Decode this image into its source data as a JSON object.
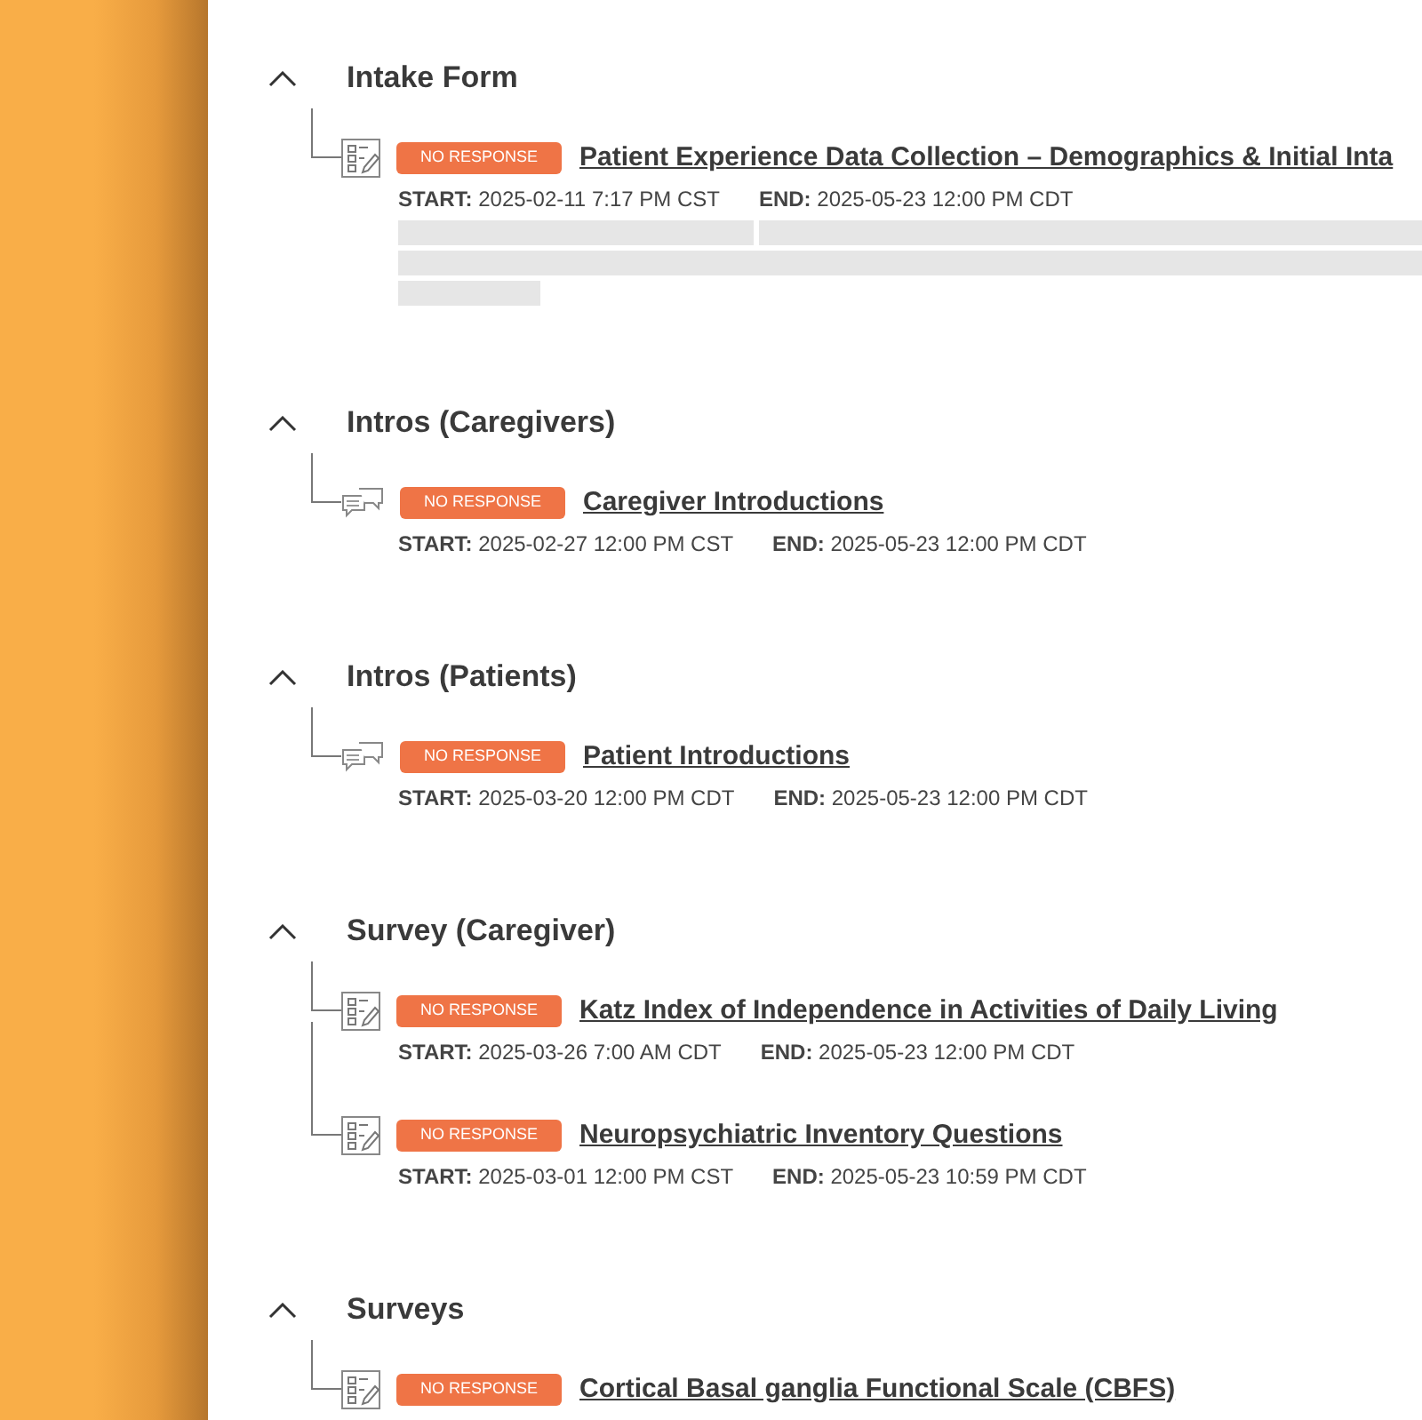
{
  "sections": [
    {
      "title": "Intake Form",
      "expanded": true,
      "items": [
        {
          "kind": "form",
          "status": "NO RESPONSE",
          "title": "Patient Experience Data Collection – Demographics & Initial Inta",
          "start_label": "START:",
          "start": "2025-02-11 7:17 PM CST",
          "end_label": "END:",
          "end": "2025-05-23 12:00 PM CDT",
          "redacted": true
        }
      ]
    },
    {
      "title": "Intros (Caregivers)",
      "expanded": true,
      "items": [
        {
          "kind": "chat",
          "status": "NO RESPONSE",
          "title": "Caregiver Introductions",
          "start_label": "START:",
          "start": "2025-02-27 12:00 PM CST",
          "end_label": "END:",
          "end": "2025-05-23 12:00 PM CDT"
        }
      ]
    },
    {
      "title": "Intros (Patients)",
      "expanded": true,
      "items": [
        {
          "kind": "chat",
          "status": "NO RESPONSE",
          "title": "Patient Introductions",
          "start_label": "START:",
          "start": "2025-03-20 12:00 PM CDT",
          "end_label": "END:",
          "end": "2025-05-23 12:00 PM CDT"
        }
      ]
    },
    {
      "title": "Survey (Caregiver)",
      "expanded": true,
      "items": [
        {
          "kind": "form",
          "status": "NO RESPONSE",
          "title": "Katz Index of Independence in Activities of Daily Living",
          "start_label": "START:",
          "start": "2025-03-26 7:00 AM CDT",
          "end_label": "END:",
          "end": "2025-05-23 12:00 PM CDT"
        },
        {
          "kind": "form",
          "status": "NO RESPONSE",
          "title": "Neuropsychiatric Inventory Questions",
          "start_label": "START:",
          "start": "2025-03-01 12:00 PM CST",
          "end_label": "END:",
          "end": "2025-05-23 10:59 PM CDT"
        }
      ]
    },
    {
      "title": "Surveys",
      "expanded": true,
      "items": [
        {
          "kind": "form",
          "status": "NO RESPONSE",
          "title": "Cortical Basal ganglia Functional Scale (CBFS)"
        }
      ]
    }
  ]
}
